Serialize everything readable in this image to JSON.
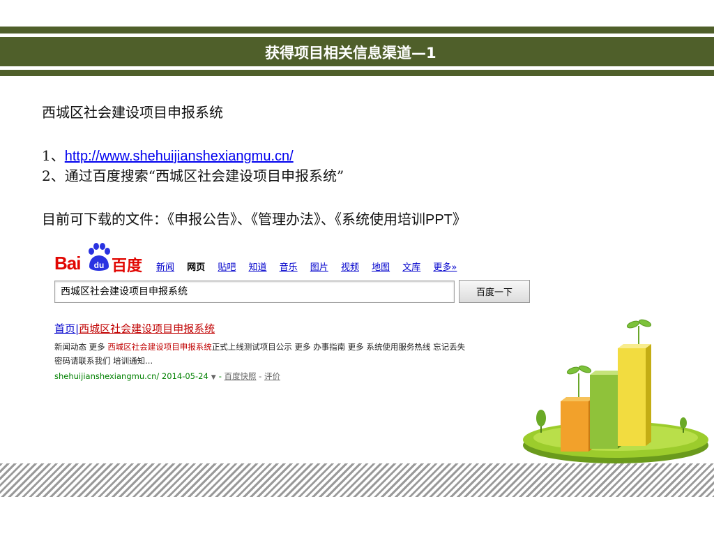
{
  "header": {
    "title": "获得项目相关信息渠道—1"
  },
  "content": {
    "system_name": "西城区社会建设项目申报系统",
    "item1_prefix": "1、",
    "item1_link": "http://www.shehuijianshexiangmu.cn/",
    "item2": "2、通过百度搜索“西城区社会建设项目申报系统”",
    "downloads_prefix": "目前可下载的文件：《申报公告》、《管理办法》、《系统使用培训",
    "downloads_suffix": "PPT》"
  },
  "baidu": {
    "logo_text": "Bai",
    "logo_paw_text": "du",
    "logo_cn": "百度",
    "nav": [
      "新闻",
      "网页",
      "贴吧",
      "知道",
      "音乐",
      "图片",
      "视频",
      "地图",
      "文库",
      "更多»"
    ],
    "nav_active_index": 1,
    "search_value": "西城区社会建设项目申报系统",
    "search_button": "百度一下",
    "result": {
      "title_prefix": "首页|",
      "title_highlight": "西城区社会建设项目申报系统",
      "desc_part1": "新闻动态 更多 ",
      "desc_highlight": "西城区社会建设项目申报系统",
      "desc_part2": "正式上线测试项目公示 更多 办事指南 更多 系统使用服务热线 忘记丢失密码请联系我们 培训通知...",
      "url": "shehuijianshexiangmu.cn/ 2014-05-24",
      "snapshot": "百度快照",
      "sep": "-",
      "review": "评价"
    }
  },
  "colors": {
    "header_green": "#4f5f2a",
    "baidu_red": "#e10602",
    "baidu_blue": "#2932e1",
    "link_blue": "#0000ee"
  }
}
